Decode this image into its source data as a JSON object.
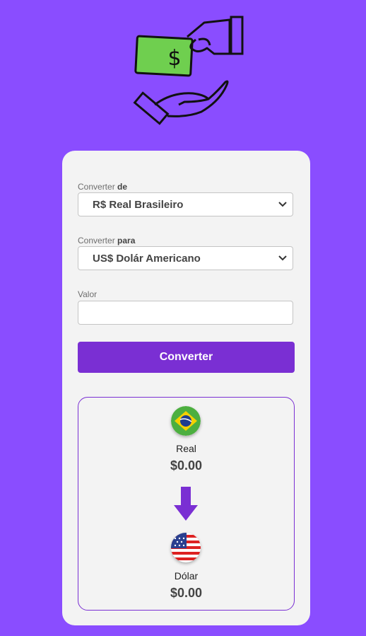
{
  "icons": {
    "hero": "money-handover-icon",
    "select_arrow": "chevron-down-icon",
    "flag_from": "brazil-flag-icon",
    "flag_to": "usa-flag-icon",
    "direction": "arrow-down-icon"
  },
  "colors": {
    "background": "#8a4dff",
    "card": "#f3f3f3",
    "accent": "#7a2fd3",
    "banknote": "#6fcf4f"
  },
  "hero": {
    "banknote_symbol": "$"
  },
  "form": {
    "from": {
      "label": "Converter",
      "label_bold": "de",
      "selected": "R$ Real Brasileiro"
    },
    "to": {
      "label": "Converter",
      "label_bold": "para",
      "selected": "US$ Dolár Americano"
    },
    "amount": {
      "label": "Valor",
      "value": ""
    },
    "submit_label": "Converter"
  },
  "result": {
    "from": {
      "name": "Real",
      "value": "$0.00"
    },
    "to": {
      "name": "Dólar",
      "value": "$0.00"
    }
  }
}
